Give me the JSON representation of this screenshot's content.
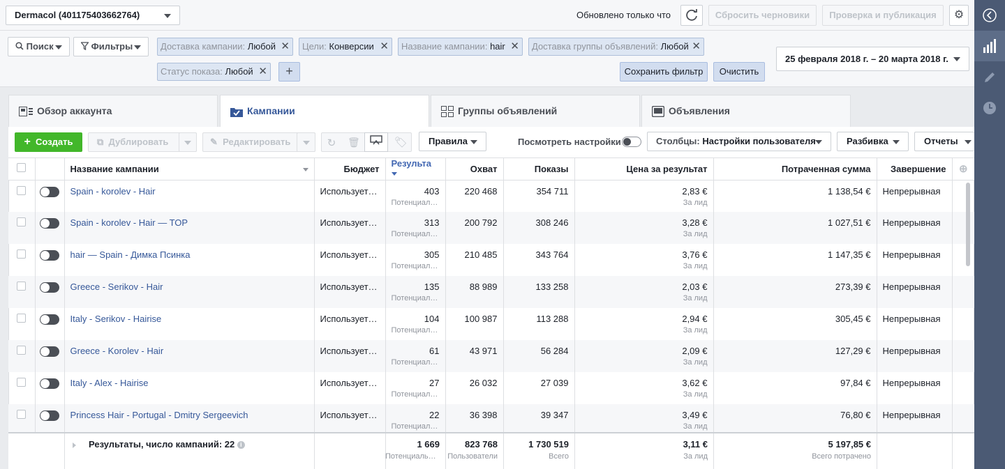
{
  "header": {
    "account": "Dermacol (401175403662764)",
    "updated_text": "Обновлено только что",
    "reset_drafts": "Сбросить черновики",
    "review_publish": "Проверка и публикация"
  },
  "filters": {
    "search": "Поиск",
    "filters": "Фильтры",
    "chips": [
      {
        "key": "Доставка кампании:",
        "value": "Любой"
      },
      {
        "key": "Цели:",
        "value": "Конверсии"
      },
      {
        "key": "Название кампании:",
        "value": "hair"
      },
      {
        "key": "Доставка группы объявлений:",
        "value": "Любой"
      },
      {
        "key": "Статус показа:",
        "value": "Любой"
      }
    ],
    "save_filter": "Сохранить фильтр",
    "clear": "Очистить",
    "date_range": "25 февраля 2018 г. – 20 марта 2018 г."
  },
  "tabs": [
    "Обзор аккаунта",
    "Кампании",
    "Группы объявлений",
    "Объявления"
  ],
  "toolbar": {
    "create": "Создать",
    "duplicate": "Дублировать",
    "edit": "Редактировать",
    "rules": "Правила",
    "view_settings": "Посмотреть настройки",
    "columns_label": "Столбцы:",
    "columns_value": "Настройки пользователя",
    "breakdown": "Разбивка",
    "reports": "Отчеты"
  },
  "table": {
    "headers": [
      "Название кампании",
      "Бюджет",
      "Результа",
      "Охват",
      "Показы",
      "Цена за результат",
      "Потраченная сумма",
      "Завершение"
    ],
    "rows": [
      {
        "name": "Spain - korolev - Hair",
        "budget": "Используется бюджет",
        "results": "403",
        "results_sub": "Потенциальные клиенты",
        "reach": "220 468",
        "impr": "354 711",
        "cpr": "2,83 €",
        "cpr_sub": "За лид",
        "spent": "1 138,54 €",
        "end": "Непрерывная"
      },
      {
        "name": "Spain - korolev - Hair — TOP",
        "budget": "Используется бюджет",
        "results": "313",
        "results_sub": "Потенциальные клиенты",
        "reach": "200 792",
        "impr": "308 246",
        "cpr": "3,28 €",
        "cpr_sub": "За лид",
        "spent": "1 027,51 €",
        "end": "Непрерывная"
      },
      {
        "name": "hair — Spain - Димка Псинка",
        "budget": "Используется бюджет",
        "results": "305",
        "results_sub": "Потенциальные клиенты",
        "reach": "210 485",
        "impr": "343 764",
        "cpr": "3,76 €",
        "cpr_sub": "За лид",
        "spent": "1 147,35 €",
        "end": "Непрерывная"
      },
      {
        "name": "Greece - Serikov - Hair",
        "budget": "Используется бюджет",
        "results": "135",
        "results_sub": "Потенциальные клиенты",
        "reach": "88 989",
        "impr": "133 258",
        "cpr": "2,03 €",
        "cpr_sub": "За лид",
        "spent": "273,39 €",
        "end": "Непрерывная"
      },
      {
        "name": "Italy - Serikov - Hairise",
        "budget": "Используется бюджет",
        "results": "104",
        "results_sub": "Потенциальные клиенты",
        "reach": "100 987",
        "impr": "113 288",
        "cpr": "2,94 €",
        "cpr_sub": "За лид",
        "spent": "305,45 €",
        "end": "Непрерывная"
      },
      {
        "name": "Greece - Korolev - Hair",
        "budget": "Используется бюджет",
        "results": "61",
        "results_sub": "Потенциальные клиенты",
        "reach": "43 971",
        "impr": "56 284",
        "cpr": "2,09 €",
        "cpr_sub": "За лид",
        "spent": "127,29 €",
        "end": "Непрерывная"
      },
      {
        "name": "Italy - Alex - Hairise",
        "budget": "Используется бюджет",
        "results": "27",
        "results_sub": "Потенциальные клиенты",
        "reach": "26 032",
        "impr": "27 039",
        "cpr": "3,62 €",
        "cpr_sub": "За лид",
        "spent": "97,84 €",
        "end": "Непрерывная"
      },
      {
        "name": "Princess Hair - Portugal - Dmitry Sergeevich",
        "budget": "Используется бюджет",
        "results": "22",
        "results_sub": "Потенциальные клиенты",
        "reach": "36 398",
        "impr": "39 347",
        "cpr": "3,49 €",
        "cpr_sub": "За лид",
        "spent": "76,80 €",
        "end": "Непрерывная"
      }
    ],
    "totals": {
      "label": "Результаты, число кампаний: 22",
      "results": "1 669",
      "results_sub": "Потенциальные клиенты",
      "reach": "823 768",
      "reach_sub": "Пользователи",
      "impr": "1 730 519",
      "impr_sub": "Всего",
      "cpr": "3,11 €",
      "cpr_sub": "За лид",
      "spent": "5 197,85 €",
      "spent_sub": "Всего потрачено"
    }
  },
  "colors": {
    "accent": "#365899",
    "create_green": "#42b72a",
    "sidebar": "#4b5a74"
  }
}
